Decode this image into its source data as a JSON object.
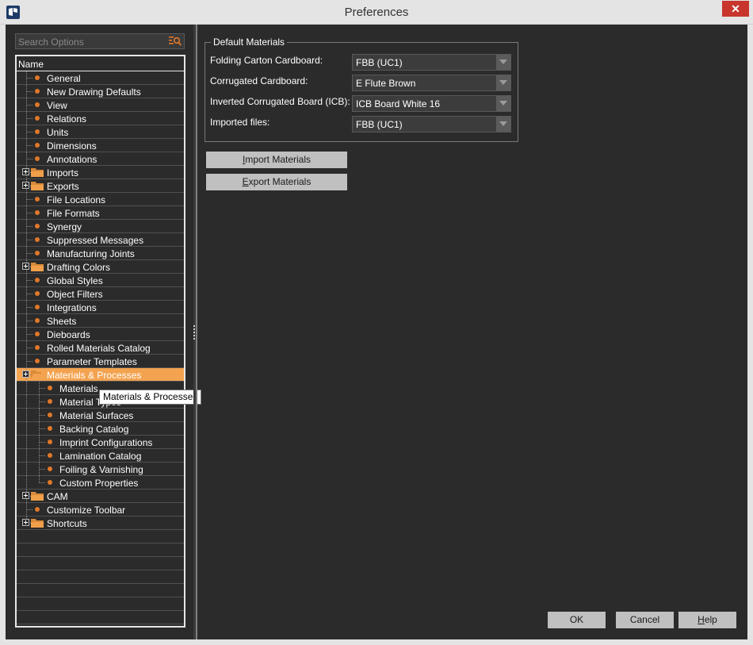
{
  "window": {
    "title": "Preferences",
    "close_label": "✕"
  },
  "search": {
    "placeholder": "Search Options",
    "value": ""
  },
  "tree": {
    "header": "Name",
    "items": [
      {
        "label": "General",
        "type": "leaf",
        "level": 0
      },
      {
        "label": "New Drawing Defaults",
        "type": "leaf",
        "level": 0
      },
      {
        "label": "View",
        "type": "leaf",
        "level": 0
      },
      {
        "label": "Relations",
        "type": "leaf",
        "level": 0
      },
      {
        "label": "Units",
        "type": "leaf",
        "level": 0
      },
      {
        "label": "Dimensions",
        "type": "leaf",
        "level": 0
      },
      {
        "label": "Annotations",
        "type": "leaf",
        "level": 0
      },
      {
        "label": "Imports",
        "type": "folder",
        "level": 0
      },
      {
        "label": "Exports",
        "type": "folder",
        "level": 0
      },
      {
        "label": "File Locations",
        "type": "leaf",
        "level": 0
      },
      {
        "label": "File Formats",
        "type": "leaf",
        "level": 0
      },
      {
        "label": "Synergy",
        "type": "leaf",
        "level": 0
      },
      {
        "label": "Suppressed Messages",
        "type": "leaf",
        "level": 0
      },
      {
        "label": "Manufacturing Joints",
        "type": "leaf",
        "level": 0
      },
      {
        "label": "Drafting Colors",
        "type": "folder",
        "level": 0
      },
      {
        "label": "Global Styles",
        "type": "leaf",
        "level": 0
      },
      {
        "label": "Object Filters",
        "type": "leaf",
        "level": 0
      },
      {
        "label": "Integrations",
        "type": "leaf",
        "level": 0
      },
      {
        "label": "Sheets",
        "type": "leaf",
        "level": 0
      },
      {
        "label": "Dieboards",
        "type": "leaf",
        "level": 0
      },
      {
        "label": "Rolled Materials Catalog",
        "type": "leaf",
        "level": 0
      },
      {
        "label": "Parameter Templates",
        "type": "leaf",
        "level": 0
      },
      {
        "label": "Materials & Processes",
        "type": "folder-open",
        "level": 0,
        "selected": true
      },
      {
        "label": "Materials",
        "type": "leaf",
        "level": 1
      },
      {
        "label": "Material Types",
        "type": "leaf",
        "level": 1
      },
      {
        "label": "Material Surfaces",
        "type": "leaf",
        "level": 1
      },
      {
        "label": "Backing Catalog",
        "type": "leaf",
        "level": 1
      },
      {
        "label": "Imprint Configurations",
        "type": "leaf",
        "level": 1
      },
      {
        "label": "Lamination Catalog",
        "type": "leaf",
        "level": 1
      },
      {
        "label": "Foiling & Varnishing",
        "type": "leaf",
        "level": 1
      },
      {
        "label": "Custom Properties",
        "type": "leaf",
        "level": 1,
        "last": true
      },
      {
        "label": "CAM",
        "type": "folder",
        "level": 0
      },
      {
        "label": "Customize Toolbar",
        "type": "leaf",
        "level": 0
      },
      {
        "label": "Shortcuts",
        "type": "folder",
        "level": 0,
        "last": true
      }
    ],
    "empty_rows": 7,
    "tooltip": "Materials & Processes"
  },
  "default_materials": {
    "title": "Default Materials",
    "fields": [
      {
        "label": "Folding Carton Cardboard:",
        "value": "FBB (UC1)"
      },
      {
        "label": "Corrugated Cardboard:",
        "value": "E Flute Brown"
      },
      {
        "label": "Inverted Corrugated Board (ICB):",
        "value": "ICB Board White 16"
      },
      {
        "label": "Imported files:",
        "value": "FBB (UC1)"
      }
    ]
  },
  "actions": {
    "import_prefix": "I",
    "import_rest": "mport Materials",
    "export_prefix": "E",
    "export_rest": "xport Materials"
  },
  "footer": {
    "ok": "OK",
    "cancel": "Cancel",
    "help_prefix": "H",
    "help_rest": "elp"
  },
  "colors": {
    "background": "#2b2b2b",
    "selection": "#f3a350",
    "bullet": "#e0782a",
    "folder": "#f0a04b",
    "close_button": "#c7352d"
  }
}
